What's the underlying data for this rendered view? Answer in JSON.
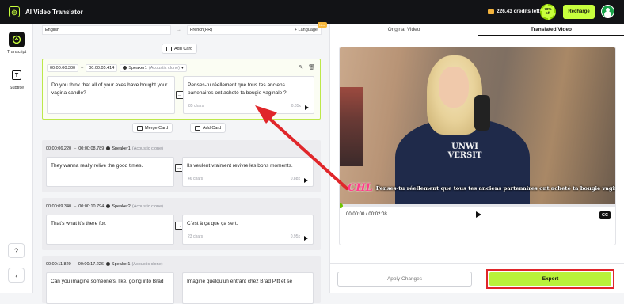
{
  "app": {
    "title": "AI Video Translator",
    "logo_text": ""
  },
  "header": {
    "credits": "226.43 credits left",
    "progress_pct": "78%",
    "progress_sub": "off",
    "recharge_label": "Recharge"
  },
  "rail": {
    "transcript_label": "Transcript",
    "subtitle_label": "Subtitle",
    "subtitle_icon": "T",
    "help_icon": "?",
    "collapse_icon": "‹"
  },
  "languages": {
    "source": "English",
    "arrow": "→",
    "target": "French(FR)",
    "add_language": "+ Language",
    "new_badge": "New"
  },
  "actions": {
    "add_card": "Add Card",
    "merge_card": "Merge Card"
  },
  "cards": [
    {
      "start": "00:00:00.300",
      "end": "00:00:05.414",
      "speaker": "Speaker1",
      "clone": "(Acoustic clone)",
      "source_text": "Do you think that all of your exes have bought your vagina candle?",
      "target_text": "Penses-tu réellement que tous tes anciens partenaires ont acheté ta bougie vaginale ?",
      "chars": "85 chars",
      "speed": "0.85x"
    },
    {
      "start": "00:00:06.220",
      "end": "00:00:08.789",
      "speaker": "Speaker1",
      "clone": "(Acoustic clone)",
      "source_text": "They wanna really relive the good times.",
      "target_text": "Ils veulent vraiment revivre les bons moments.",
      "chars": "46 chars",
      "speed": "0.88x"
    },
    {
      "start": "00:00:09.340",
      "end": "00:00:10.794",
      "speaker": "Speaker2",
      "clone": "(Acoustic clone)",
      "source_text": "That's what it's there for.",
      "target_text": "C'est à ça que ça sert.",
      "chars": "23 chars",
      "speed": "0.95x"
    },
    {
      "start": "00:00:11.820",
      "end": "00:00:17.226",
      "speaker": "Speaker1",
      "clone": "(Acoustic clone)",
      "source_text": "Can you imagine someone's, like, going into Brad",
      "target_text": "Imagine quelqu'un entrant chez Brad Pitt et se",
      "chars": "",
      "speed": ""
    }
  ],
  "right": {
    "tab_original": "Original Video",
    "tab_translated": "Translated Video",
    "caption_logo": "CHL",
    "caption": "Penses-tu réellement que tous tes anciens partenaires ont acheté ta bougie vaginale ?",
    "sweater_text": "UNWI VERSIT",
    "timecode": "00:00:00 / 00:02:08",
    "cc_label": "CC",
    "playback_progress": 0.0,
    "apply_label": "Apply Changes",
    "export_label": "Export"
  },
  "colors": {
    "accent": "#c8ff3d",
    "export": "#b9f23a",
    "highlight": "#e0262a",
    "topbar": "#121316"
  }
}
